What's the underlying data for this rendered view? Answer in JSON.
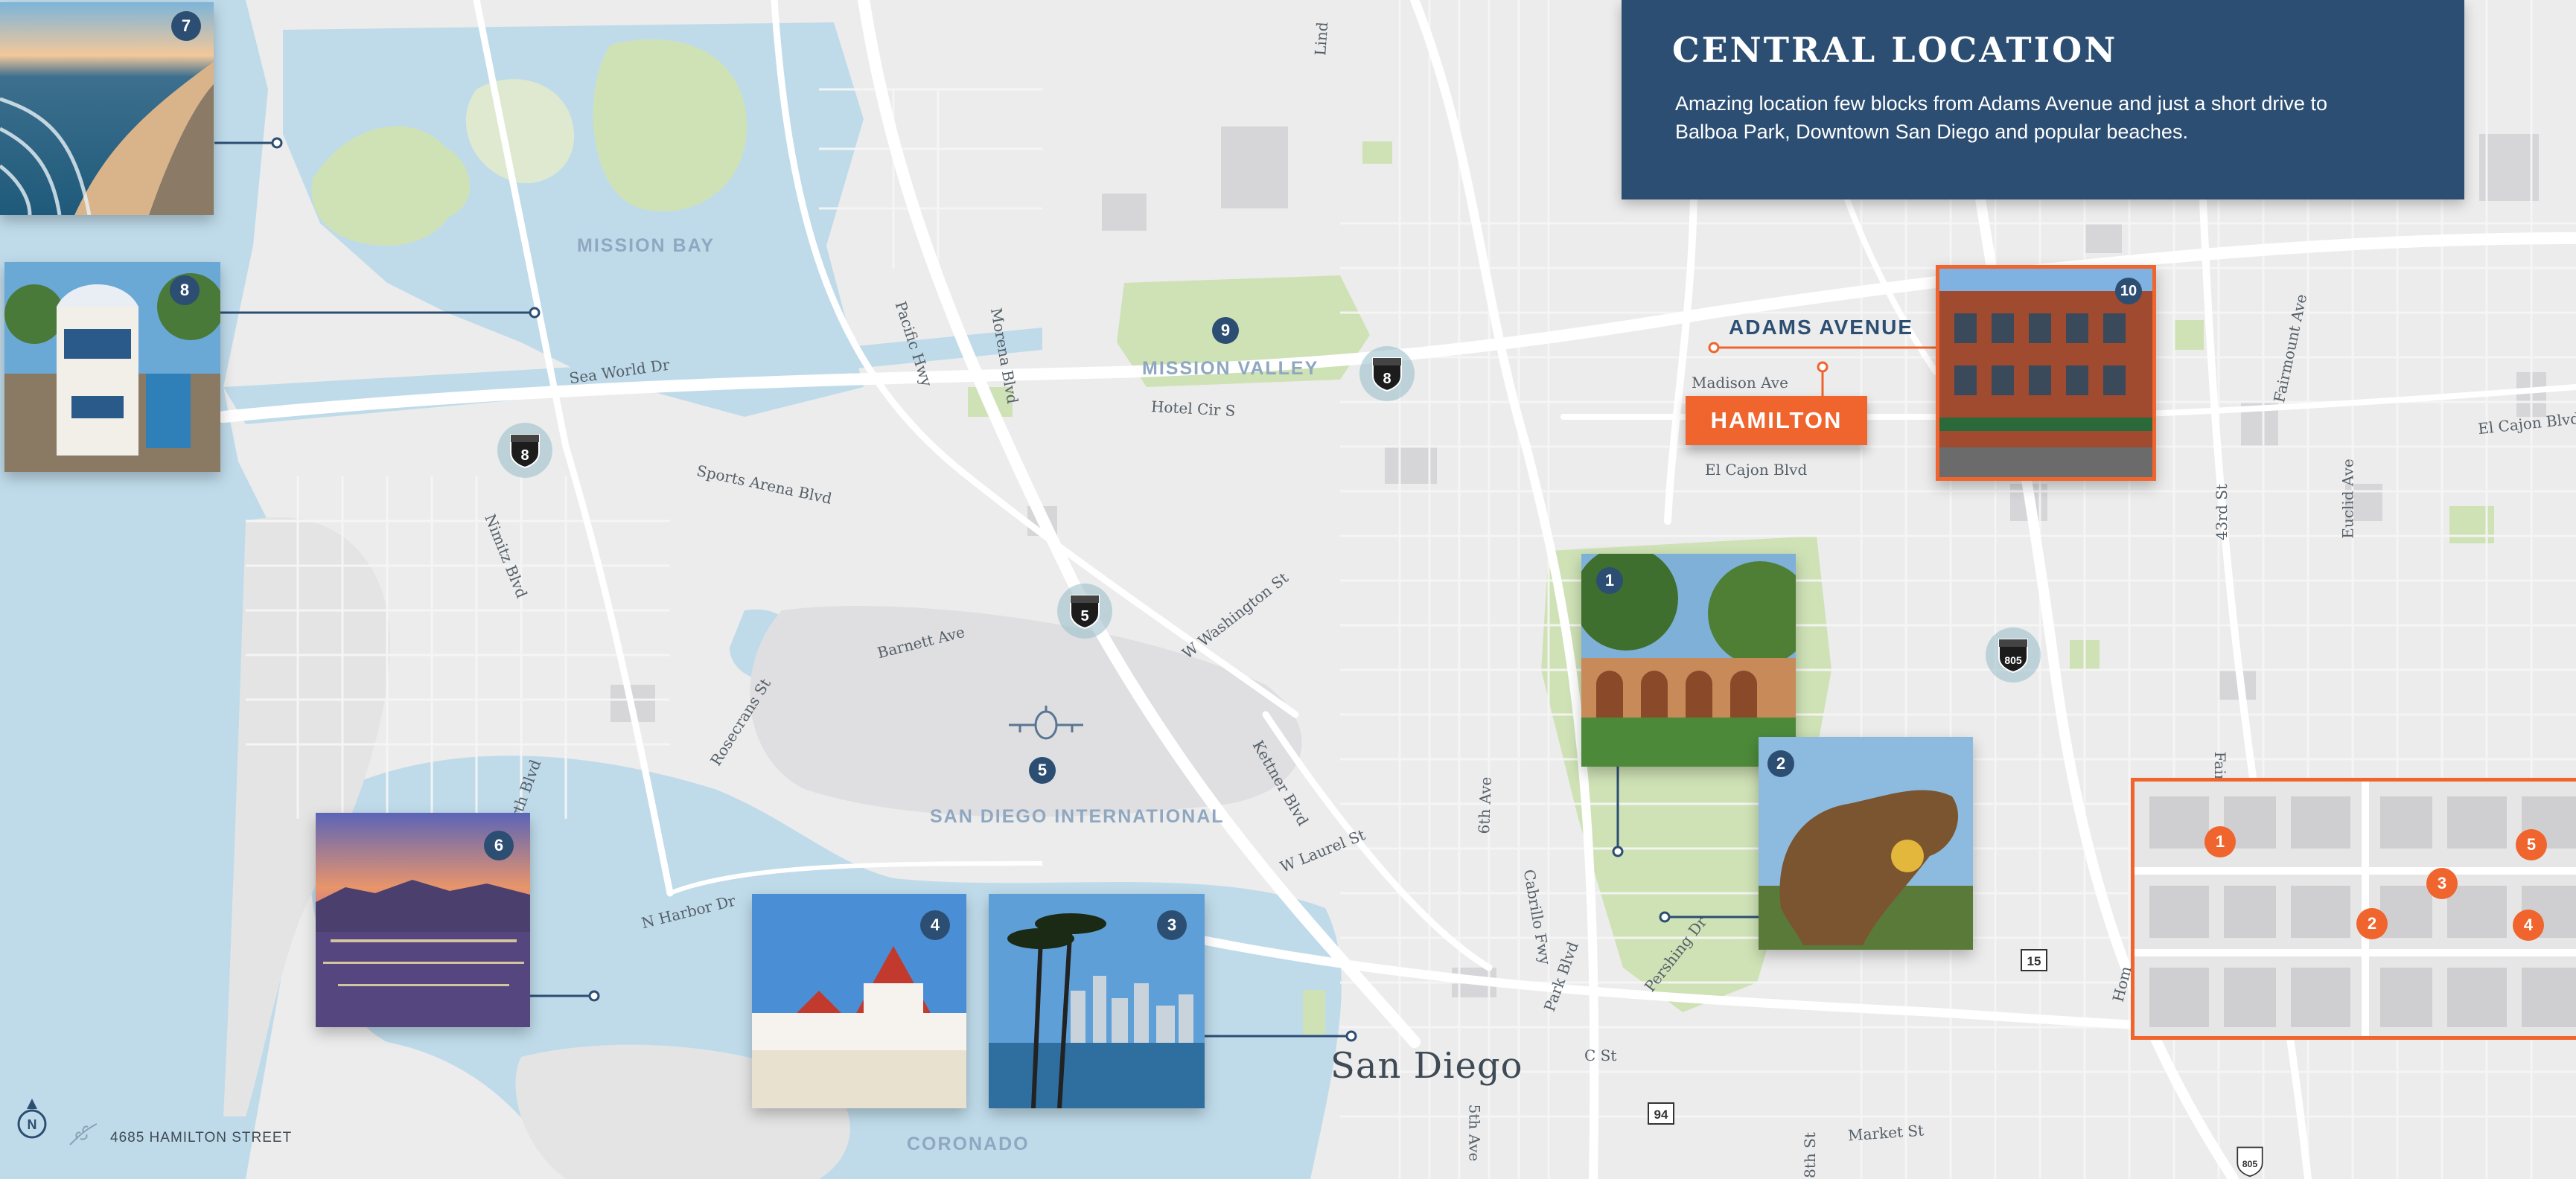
{
  "info_panel": {
    "title": "CENTRAL LOCATION",
    "body": "Amazing location few blocks from Adams Avenue and just a short drive to Balboa Park, Downtown San Diego and popular beaches."
  },
  "areas": {
    "mission_bay": "MISSION BAY",
    "mission_valley": "MISSION VALLEY",
    "airport": "SAN DIEGO INTERNATIONAL",
    "coronado": "CORONADO"
  },
  "city_label": "San Diego",
  "adams_label": "ADAMS AVENUE",
  "hamilton_label": "HAMILTON",
  "streets": {
    "sea_world_dr": "Sea World Dr",
    "sports_arena_blvd": "Sports Arena Blvd",
    "nimitz_blvd": "Nimitz Blvd",
    "pacific_hwy": "Pacific Hwy",
    "morena_blvd": "Morena Blvd",
    "hotel_cir_s": "Hotel Cir S",
    "barnett_ave": "Barnett Ave",
    "w_washington_st": "W Washington St",
    "rosecrans_st": "Rosecrans St",
    "kettner_blvd": "Kettner Blvd",
    "w_laurel_st": "W Laurel St",
    "n_harbor_dr": "N Harbor Dr",
    "north_blvd": "rth Blvd",
    "sixth_ave": "6th Ave",
    "cabrillo_fwy": "Cabrillo Fwy",
    "park_blvd": "Park Blvd",
    "pershing_dr": "Pershing Dr",
    "c_st": "C St",
    "fifth_ave": "5th Ave",
    "eighth_st": "8th St",
    "market_st": "Market St",
    "madison_ave": "Madison Ave",
    "el_cajon_blvd": "El Cajon Blvd",
    "el_cajon_blvd_east": "El Cajon Blvd",
    "fairmount_ave": "Fairmount Ave",
    "forty_third_st": "43rd St",
    "euclid_ave": "Euclid Ave",
    "linda": "Lind",
    "hom": "Hom",
    "fair": "Fair"
  },
  "highway_shields": [
    {
      "number": "8",
      "type": "interstate"
    },
    {
      "number": "8",
      "type": "interstate"
    },
    {
      "number": "5",
      "type": "interstate"
    },
    {
      "number": "805",
      "type": "interstate"
    },
    {
      "number": "805",
      "type": "interstate"
    },
    {
      "number": "15",
      "type": "state"
    },
    {
      "number": "94",
      "type": "state"
    }
  ],
  "photos": [
    {
      "number": "1",
      "subject": "Balboa Park"
    },
    {
      "number": "2",
      "subject": "San Diego Zoo lion statue"
    },
    {
      "number": "3",
      "subject": "Downtown skyline with palms"
    },
    {
      "number": "4",
      "subject": "Hotel del Coronado"
    },
    {
      "number": "5",
      "subject": "Airport"
    },
    {
      "number": "6",
      "subject": "Skyline at dusk"
    },
    {
      "number": "7",
      "subject": "Pacific Beach coastline"
    },
    {
      "number": "8",
      "subject": "SeaWorld lighthouse"
    },
    {
      "number": "9",
      "subject": "Mission Valley"
    },
    {
      "number": "10",
      "subject": "Adams Avenue storefront"
    }
  ],
  "inset_markers": [
    "1",
    "2",
    "3",
    "4",
    "5"
  ],
  "footer": {
    "compass_label": "N",
    "address": "4685 HAMILTON STREET"
  },
  "colors": {
    "navy": "#2c4e72",
    "orange": "#f0642d",
    "water": "#bfdbea",
    "land": "#ececec",
    "park": "#cfe2b6"
  }
}
